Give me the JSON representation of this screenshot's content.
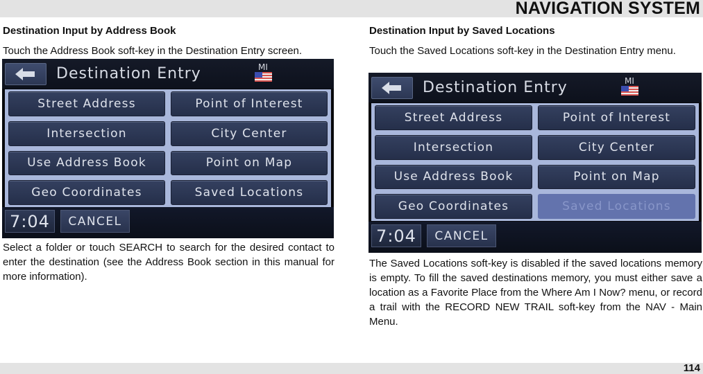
{
  "header": {
    "title": "NAVIGATION SYSTEM"
  },
  "footer": {
    "page_number": "114"
  },
  "left": {
    "heading": "Destination Input by Address Book",
    "intro": "Touch the Address Book soft-key in the Destination Entry screen.",
    "after": "Select a folder or touch SEARCH to search for the desired con­tact to enter the destination (see the Address Book section in this manual for more information).",
    "screen": {
      "title": "Destination Entry",
      "state": "MI",
      "icons": {
        "back": "left-arrow-icon",
        "flag": "us-flag-icon"
      },
      "keys": [
        "Street Address",
        "Point of Interest",
        "Intersection",
        "City Center",
        "Use Address Book",
        "Point on Map",
        "Geo Coordinates",
        "Saved Locations"
      ],
      "disabled_keys": [],
      "clock": "7:04",
      "cancel": "CANCEL"
    }
  },
  "right": {
    "heading": "Destination Input by Saved Locations",
    "intro": "Touch the Saved Locations soft-key in the Destination Entry menu.",
    "after": "The Saved Locations soft-key is disabled if the saved locations memory is empty. To fill the saved destinations memory, you must either save a location as a Favorite Place from the Where Am I Now? menu, or record a trail with the RECORD NEW TRAIL soft-key from the NAV - Main Menu.",
    "screen": {
      "title": "Destination Entry",
      "state": "MI",
      "icons": {
        "back": "left-arrow-icon",
        "flag": "us-flag-icon"
      },
      "keys": [
        "Street Address",
        "Point of Interest",
        "Intersection",
        "City Center",
        "Use Address Book",
        "Point on Map",
        "Geo Coordinates",
        "Saved Locations"
      ],
      "disabled_keys": [
        "Saved Locations"
      ],
      "clock": "7:04",
      "cancel": "CANCEL"
    }
  },
  "colors": {
    "band": "#e3e3e3",
    "key_bg": "#2c3754",
    "grid_bg": "#a9b7db",
    "disabled_key": "#6373ad"
  }
}
